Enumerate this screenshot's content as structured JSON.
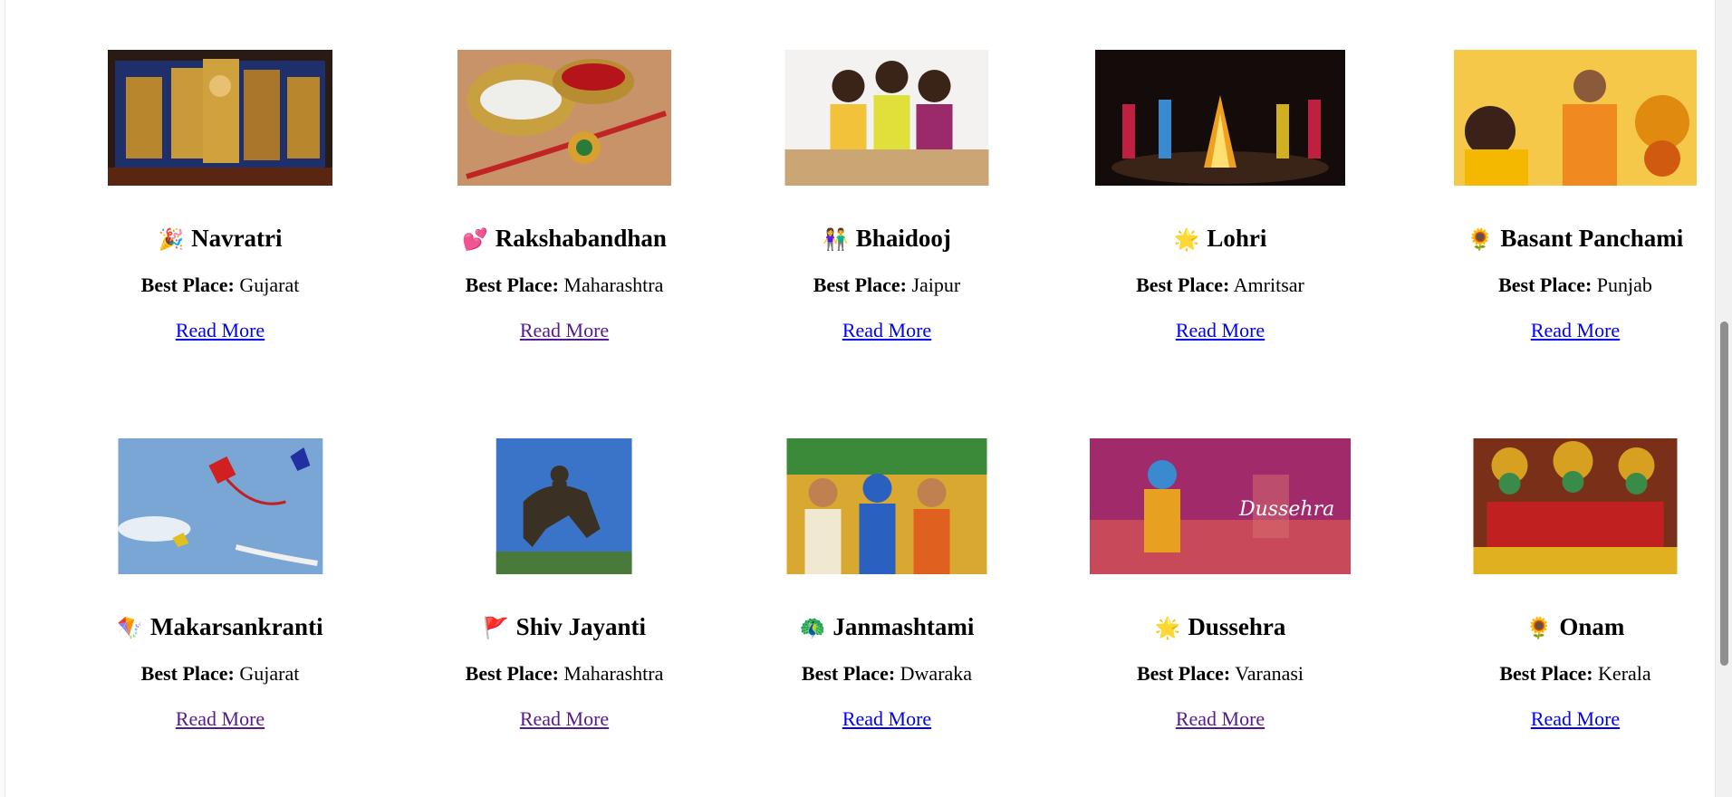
{
  "best_place_label": "Best Place:",
  "festivals": [
    {
      "name": "Navratri",
      "emoji": "🎉",
      "place": "Gujarat",
      "link": "Read More",
      "visited": false
    },
    {
      "name": "Rakshabandhan",
      "emoji": "💕",
      "place": "Maharashtra",
      "link": "Read More",
      "visited": true
    },
    {
      "name": "Bhaidooj",
      "emoji": "👫",
      "place": "Jaipur",
      "link": "Read More",
      "visited": false
    },
    {
      "name": "Lohri",
      "emoji": "🌟",
      "place": "Amritsar",
      "link": "Read More",
      "visited": false
    },
    {
      "name": "Basant Panchami",
      "emoji": "🌻",
      "place": "Punjab",
      "link": "Read More",
      "visited": false
    },
    {
      "name": "Makarsankranti",
      "emoji": "🪁",
      "place": "Gujarat",
      "link": "Read More",
      "visited": true
    },
    {
      "name": "Shiv Jayanti",
      "emoji": "🚩",
      "place": "Maharashtra",
      "link": "Read More",
      "visited": true
    },
    {
      "name": "Janmashtami",
      "emoji": "🦚",
      "place": "Dwaraka",
      "link": "Read More",
      "visited": false
    },
    {
      "name": "Dussehra",
      "emoji": "🌟",
      "place": "Varanasi",
      "link": "Read More",
      "visited": true
    },
    {
      "name": "Onam",
      "emoji": "🌻",
      "place": "Kerala",
      "link": "Read More",
      "visited": false
    }
  ],
  "image_text": {
    "dussehra_banner": "Dussehra"
  }
}
